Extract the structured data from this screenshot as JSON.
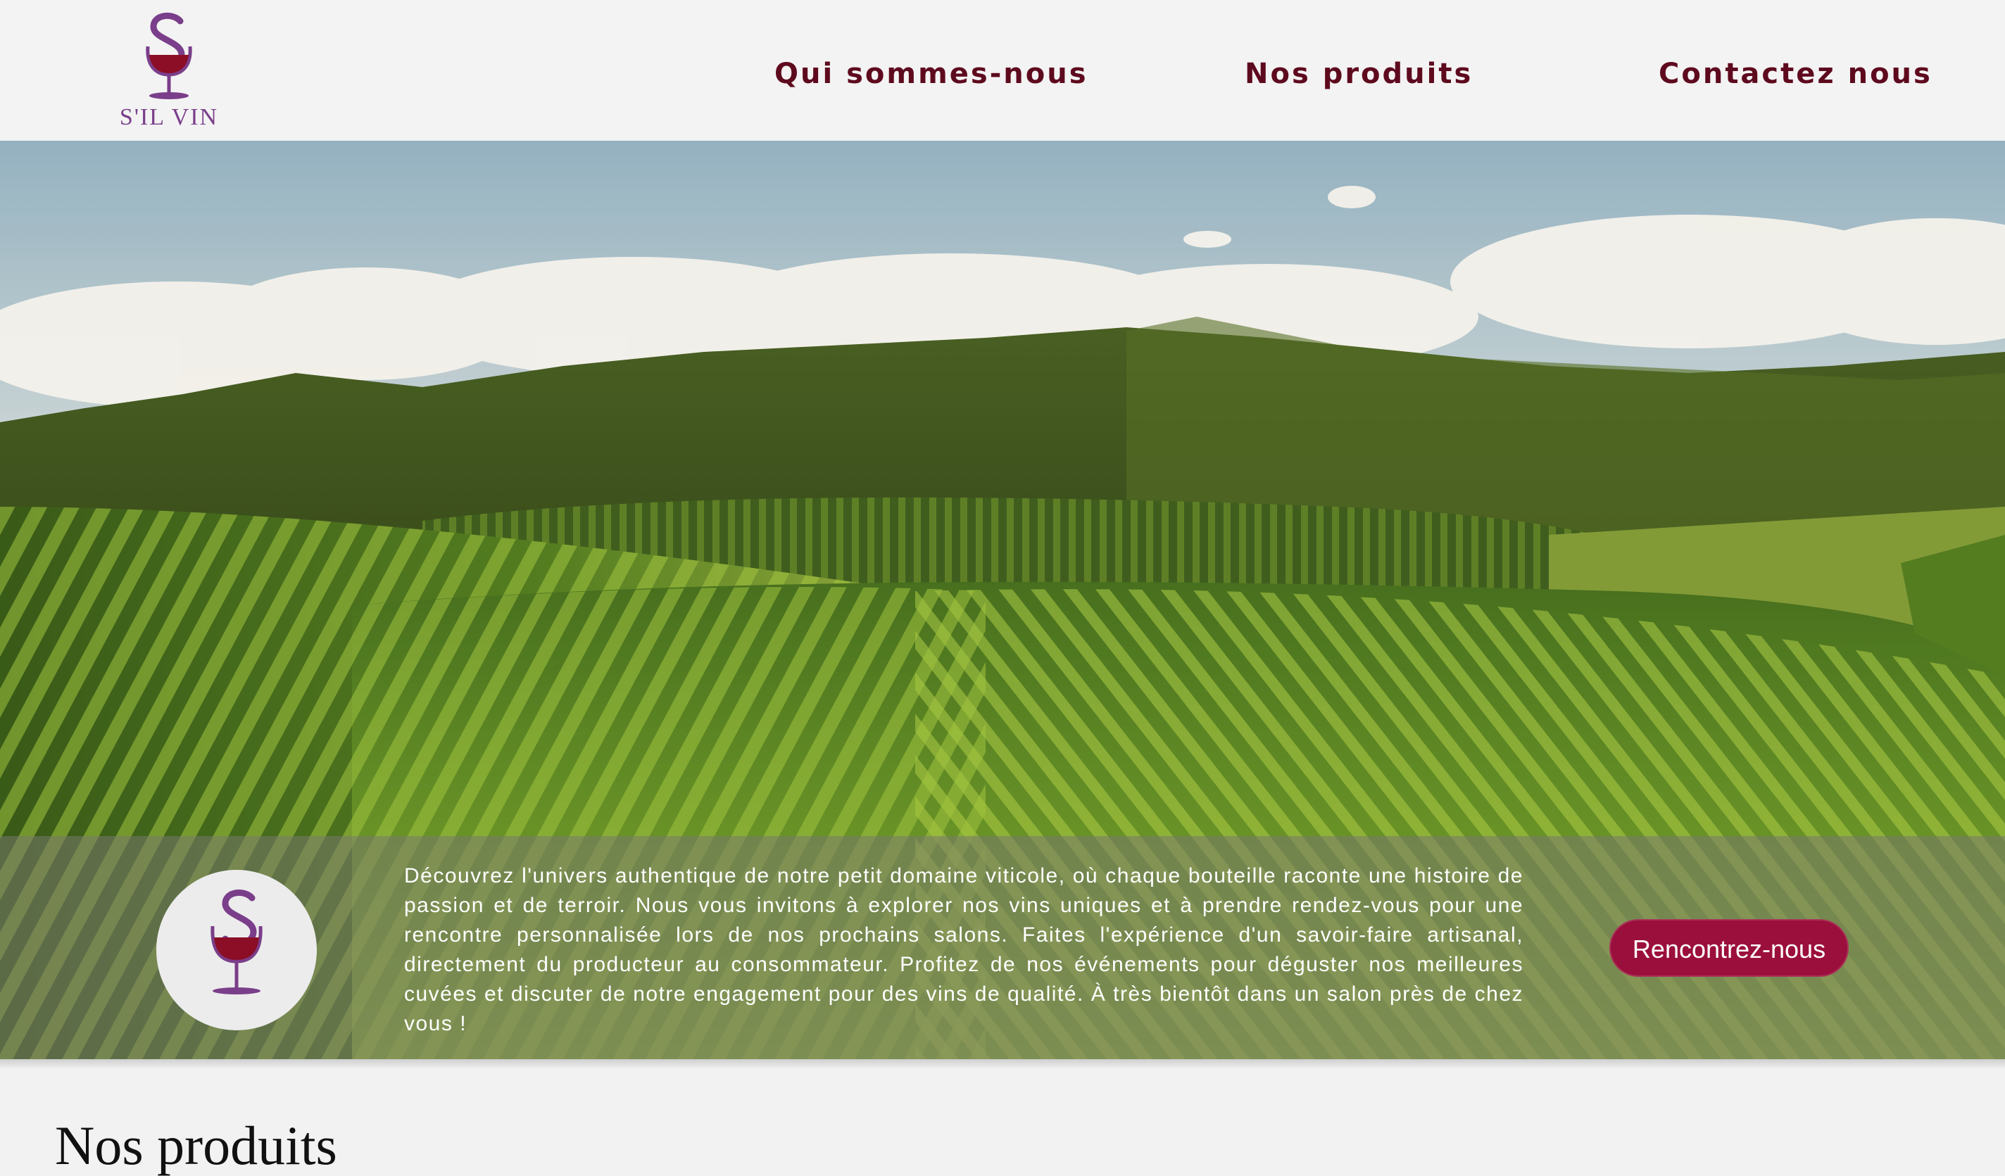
{
  "brand": {
    "logo_text": "S'IL VIN",
    "colors": {
      "wine": "#5e0a1e",
      "accent": "#9b0f3c",
      "logo_purple": "#7a3e8a"
    }
  },
  "nav": {
    "items": [
      {
        "label": "Qui sommes-nous"
      },
      {
        "label": "Nos produits"
      },
      {
        "label": "Contactez nous"
      }
    ]
  },
  "hero": {
    "image": "vineyard-landscape"
  },
  "band": {
    "text": "Découvrez l'univers authentique de notre petit domaine viticole, où chaque bouteille raconte une histoire de passion et de terroir. Nous vous invitons à explorer nos vins uniques et à prendre rendez-vous pour une rencontre personnalisée lors de nos prochains salons. Faites l'expérience d'un savoir-faire artisanal, directement du producteur au consommateur. Profitez de nos événements pour déguster nos meilleures cuvées et discuter de notre engagement pour des vins de qualité. À très bientôt dans un salon près de chez vous !",
    "cta_label": "Rencontrez-nous"
  },
  "section": {
    "title": "Nos produits"
  }
}
